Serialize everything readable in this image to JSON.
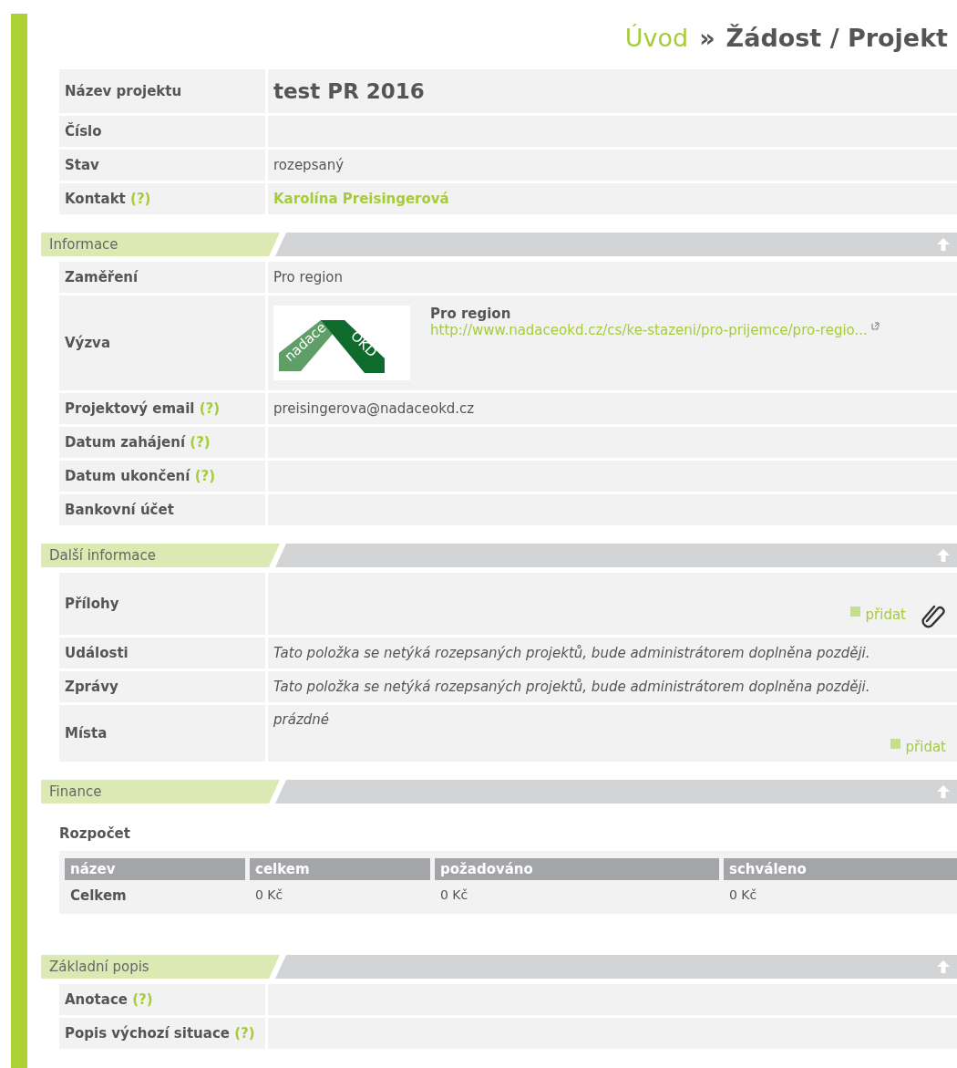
{
  "breadcrumb": {
    "home": "Úvod",
    "separator": "»",
    "current": "Žádost / Projekt"
  },
  "summary": [
    {
      "label": "Název projektu",
      "kind": "title",
      "value": "test PR 2016"
    },
    {
      "label": "Číslo",
      "kind": "empty"
    },
    {
      "label": "Stav",
      "kind": "text",
      "value": "rozepsaný"
    },
    {
      "label": "Kontakt",
      "help": "(?)",
      "kind": "contact",
      "value": "Karolína Preisingerová"
    }
  ],
  "sections": [
    {
      "title": "Informace",
      "kind": "fields",
      "rows": [
        {
          "label": "Zaměření",
          "kind": "text",
          "value": "Pro region"
        },
        {
          "label": "Výzva",
          "kind": "call",
          "logo": [
            "nadace",
            "OKD"
          ],
          "name": "Pro region",
          "link": "http://www.nadaceokd.cz/cs/ke-stazeni/pro-prijemce/pro-regio..."
        },
        {
          "label": "Projektový email",
          "help": "(?)",
          "kind": "text",
          "value": "preisingerova@nadaceokd.cz"
        },
        {
          "label": "Datum zahájení",
          "help": "(?)",
          "kind": "empty"
        },
        {
          "label": "Datum ukončení",
          "help": "(?)",
          "kind": "empty"
        },
        {
          "label": "Bankovní účet",
          "kind": "empty"
        }
      ]
    },
    {
      "title": "Další informace",
      "kind": "fields",
      "rows": [
        {
          "label": "Přílohy",
          "kind": "attachments",
          "action": "přidat"
        },
        {
          "label": "Události",
          "kind": "note",
          "value": "Tato položka se netýká rozepsaných projektů, bude administrátorem doplněna později."
        },
        {
          "label": "Zprávy",
          "kind": "note",
          "value": "Tato položka se netýká rozepsaných projektů, bude administrátorem doplněna později."
        },
        {
          "label": "Místa",
          "kind": "places",
          "note": "prázdné",
          "action": "přidat"
        }
      ]
    },
    {
      "title": "Finance",
      "kind": "budget",
      "subtitle": "Rozpočet",
      "columns": [
        "název",
        "celkem",
        "požadováno",
        "schváleno"
      ],
      "rows": [
        [
          "Celkem",
          "0 Kč",
          "0 Kč",
          "0 Kč"
        ]
      ]
    },
    {
      "title": "Základní popis",
      "kind": "fields",
      "rows": [
        {
          "label": "Anotace",
          "help": "(?)",
          "kind": "empty"
        },
        {
          "label": "Popis výchozí situace",
          "help": "(?)",
          "kind": "empty"
        }
      ]
    }
  ]
}
